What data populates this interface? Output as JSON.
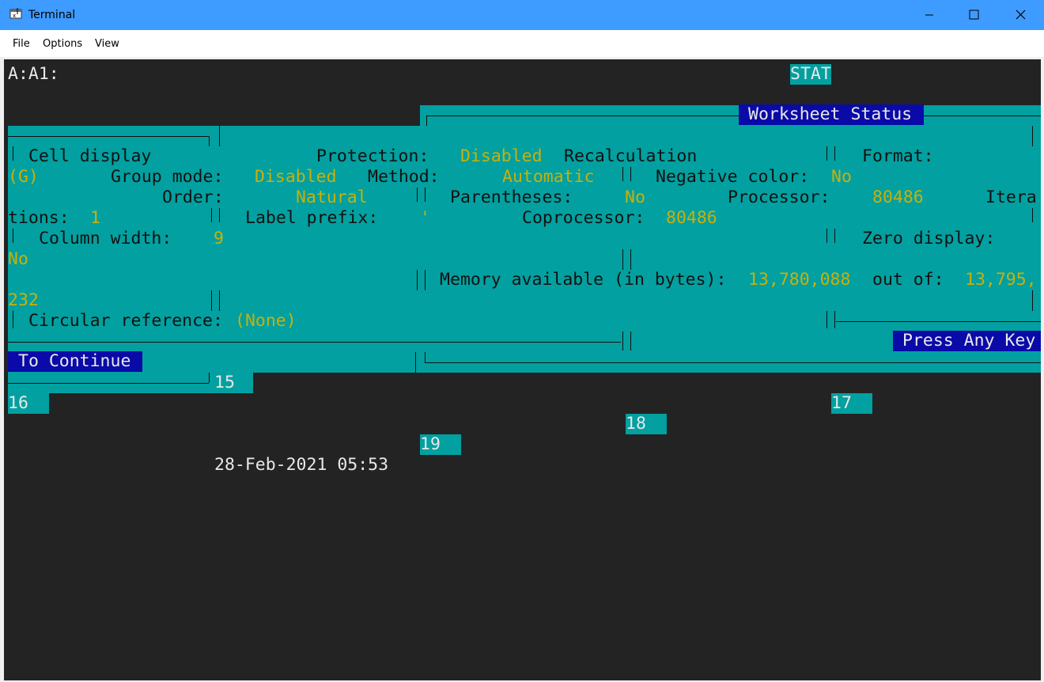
{
  "window": {
    "title": "Terminal",
    "controls": {
      "minimize": "—",
      "maximize": "☐",
      "close": "✕"
    }
  },
  "menu": [
    "File",
    "Options",
    "View"
  ],
  "screen": {
    "cell_address": "A:A1:",
    "mode_indicator": "STAT",
    "dialog_title": "Worksheet Status",
    "rows": {
      "r1_cell_display": "Cell display",
      "r1_protection": "Protection:",
      "r1_protection_val": "Disabled",
      "r1_recalculation": "Recalculation",
      "r1_format": "Format:",
      "r2_format_val": "(G)",
      "r2_group_mode": "Group mode:",
      "r2_group_mode_val": "Disabled",
      "r2_method": "Method:",
      "r2_method_val": "Automatic",
      "r2_negative_color": "Negative color:",
      "r2_negative_color_val": "No",
      "r3_order": "Order:",
      "r3_order_val": "Natural",
      "r3_parentheses": "Parentheses:",
      "r3_parentheses_val": "No",
      "r3_processor": "Processor:",
      "r3_processor_val": "80486",
      "r3_itera": "Itera",
      "r4_tions": "tions:",
      "r4_tions_val": "1",
      "r4_label_prefix": "Label prefix:",
      "r4_label_prefix_val": "'",
      "r4_coprocessor": "Coprocessor:",
      "r4_coprocessor_val": "80486",
      "r5_column_width": "Column width:",
      "r5_column_width_val": "9",
      "r5_zero_display": "Zero display:",
      "r6_zero_display_val": "No",
      "r7_memory": "Memory available (in bytes):",
      "r7_memory_val": "13,780,088",
      "r7_out_of": "out of:",
      "r7_out_of_val": "13,795,",
      "r8_out_of_val_cont": "232",
      "r9_circular": "Circular reference:",
      "r9_circular_val": "(None)",
      "press_any_key": "Press Any Key",
      "to_continue": "To Continue"
    },
    "row_numbers": [
      "15",
      "16",
      "17",
      "18",
      "19"
    ],
    "datetime": "28-Feb-2021 05:53"
  },
  "colors": {
    "titlebar": "#3e9bff",
    "terminal_bg": "#232323",
    "dialog_bg": "#02a0a0",
    "highlight_bg": "#0a0aa8",
    "value_text": "#c8b00a"
  }
}
